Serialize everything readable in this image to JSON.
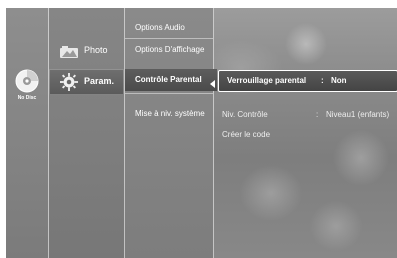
{
  "disc": {
    "icon": "disc-icon",
    "label": "No Disc"
  },
  "categories": [
    {
      "label": "Photo",
      "icon": "photo-icon",
      "active": false
    },
    {
      "label": "Param.",
      "icon": "gear-icon",
      "active": true
    }
  ],
  "submenu": [
    {
      "label": "Options Audio",
      "active": false
    },
    {
      "label": "Options D'affichage",
      "active": false
    },
    {
      "label": "Contrôle Parental",
      "active": true
    },
    {
      "label": "Mise à niv. système",
      "active": false
    }
  ],
  "options": [
    {
      "label": "Verrouillage parental",
      "separator": ":",
      "value": "Non",
      "selected": true
    },
    {
      "label": "Niv. Contrôle",
      "separator": ":",
      "value": "Niveau1 (enfants)",
      "selected": false
    },
    {
      "label": "Créer le code",
      "separator": "",
      "value": "",
      "selected": false
    }
  ],
  "colors": {
    "text": "#ffffff",
    "highlight": "#4b4b4b",
    "panel": "#8a8a8a"
  }
}
